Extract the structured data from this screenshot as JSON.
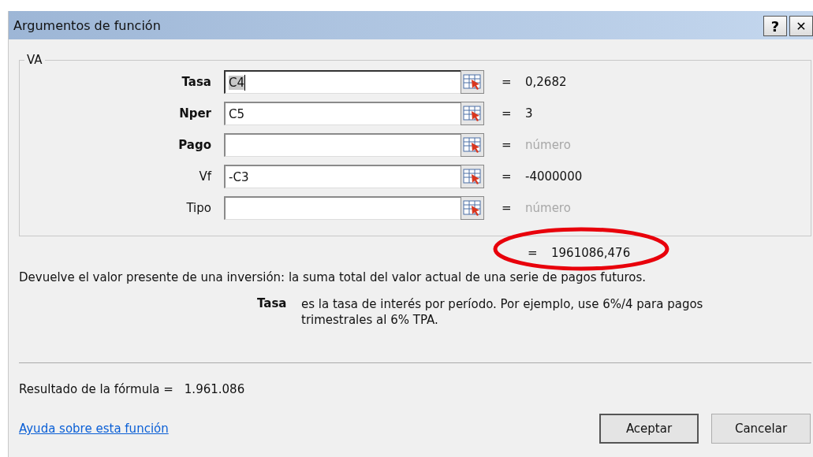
{
  "window": {
    "title": "Argumentos de función",
    "buttons": [
      {
        "kind": "help",
        "label": "?"
      },
      {
        "kind": "close",
        "label": "✕"
      }
    ]
  },
  "group": {
    "title": "VA",
    "arguments": [
      {
        "label": "Tasa",
        "required": true,
        "value": "C4",
        "focused": true,
        "equals": "=",
        "result": "0,2682",
        "muted": false
      },
      {
        "label": "Nper",
        "required": true,
        "value": "C5",
        "focused": false,
        "equals": "=",
        "result": "3",
        "muted": false
      },
      {
        "label": "Pago",
        "required": true,
        "focused": false,
        "equals": "=",
        "result": "número",
        "muted": true
      },
      {
        "label": "Vf",
        "required": false,
        "value": "-C3",
        "focused": false,
        "equals": "=",
        "result": "-4000000",
        "muted": false
      },
      {
        "label": "Tipo",
        "required": false,
        "focused": false,
        "equals": "=",
        "result": "número",
        "muted": true
      }
    ]
  },
  "function_result": {
    "equals": "=",
    "value": "1961086,476",
    "circled": true
  },
  "description": "Devuelve el valor presente de una inversión: la suma total del valor actual de una serie de pagos futuros.",
  "argument_help": {
    "name": "Tasa",
    "text": "es la tasa de interés por período. Por ejemplo, use 6%/4 para pagos trimestrales al 6% TPA."
  },
  "formula_result": {
    "label": "Resultado de la fórmula =",
    "value": "1.961.086"
  },
  "help_link": "Ayuda sobre esta función",
  "buttons": [
    "Aceptar",
    "Cancelar"
  ]
}
